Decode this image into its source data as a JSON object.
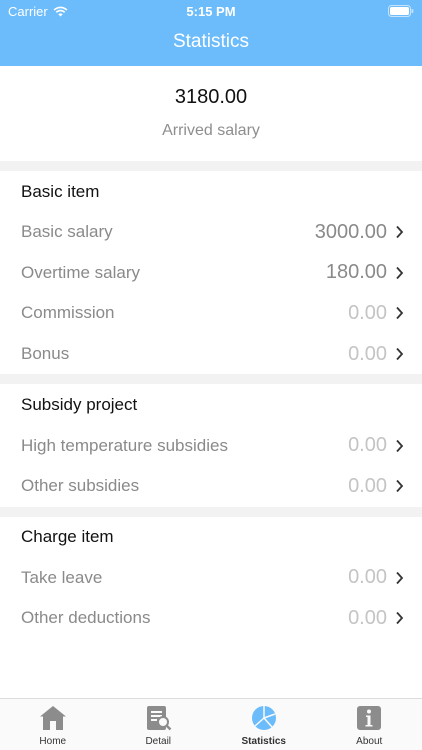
{
  "status_bar": {
    "carrier": "Carrier",
    "time": "5:15 PM"
  },
  "nav": {
    "title": "Statistics"
  },
  "summary": {
    "amount": "3180.00",
    "label": "Arrived salary"
  },
  "sections": {
    "basic": {
      "title": "Basic item",
      "rows": [
        {
          "label": "Basic salary",
          "value": "3000.00"
        },
        {
          "label": "Overtime salary",
          "value": "180.00"
        },
        {
          "label": "Commission",
          "value": "0.00"
        },
        {
          "label": "Bonus",
          "value": "0.00"
        }
      ]
    },
    "subsidy": {
      "title": "Subsidy project",
      "rows": [
        {
          "label": "High temperature subsidies",
          "value": "0.00"
        },
        {
          "label": "Other subsidies",
          "value": "0.00"
        }
      ]
    },
    "charge": {
      "title": "Charge item",
      "rows": [
        {
          "label": "Take leave",
          "value": "0.00"
        },
        {
          "label": "Other deductions",
          "value": "0.00"
        }
      ]
    }
  },
  "tabbar": {
    "home": "Home",
    "detail": "Detail",
    "statistics": "Statistics",
    "about": "About"
  },
  "icons": {
    "home": "home-icon",
    "detail": "detail-search-icon",
    "statistics": "pie-chart-icon",
    "about": "info-icon"
  },
  "colors": {
    "header": "#6cbcfb",
    "active_tab": "#6cbcfb",
    "inactive_tab": "#8c8c8c"
  }
}
